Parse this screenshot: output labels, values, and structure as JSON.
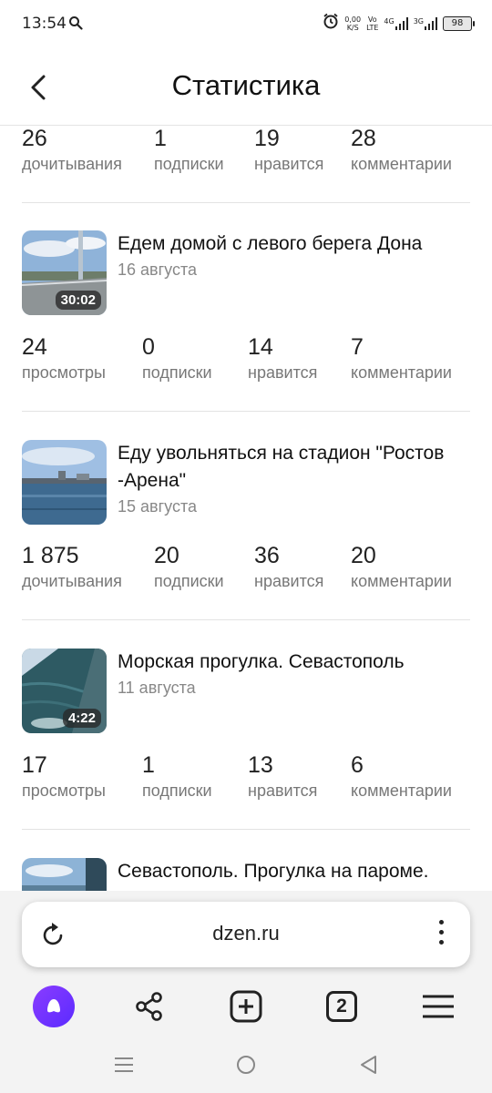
{
  "status_bar": {
    "time": "13:54",
    "net_speed_value": "0,00",
    "net_speed_unit": "K/S",
    "volte_top": "Vo",
    "volte_bottom": "LTE",
    "signal1": "4G",
    "signal2": "3G",
    "battery": "98"
  },
  "header": {
    "title": "Статистика"
  },
  "top_stats": [
    {
      "value": "26",
      "label": "дочитывания"
    },
    {
      "value": "1",
      "label": "подписки"
    },
    {
      "value": "19",
      "label": "нравится"
    },
    {
      "value": "28",
      "label": "комментарии"
    }
  ],
  "videos": [
    {
      "title": "Едем домой с левого берега Дона",
      "date": "16 августа",
      "duration": "30:02",
      "stats": [
        {
          "value": "24",
          "label": "просмотры"
        },
        {
          "value": "0",
          "label": "подписки"
        },
        {
          "value": "14",
          "label": "нравится"
        },
        {
          "value": "7",
          "label": "комментарии"
        }
      ]
    },
    {
      "title": "Еду увольняться на стадион \"Ростов -Арена\"",
      "date": "15 августа",
      "duration": "",
      "stats": [
        {
          "value": "1 875",
          "label": "дочитывания"
        },
        {
          "value": "20",
          "label": "подписки"
        },
        {
          "value": "36",
          "label": "нравится"
        },
        {
          "value": "20",
          "label": "комментарии"
        }
      ]
    },
    {
      "title": "Морская прогулка. Севастополь",
      "date": "11 августа",
      "duration": "4:22",
      "stats": [
        {
          "value": "17",
          "label": "просмотры"
        },
        {
          "value": "1",
          "label": "подписки"
        },
        {
          "value": "13",
          "label": "нравится"
        },
        {
          "value": "6",
          "label": "комментарии"
        }
      ]
    },
    {
      "title": "Севастополь. Прогулка на пароме.",
      "date": "",
      "duration": ""
    }
  ],
  "browser": {
    "url": "dzen.ru",
    "tab_count": "2"
  },
  "icons": {
    "search": "search-icon",
    "alarm": "alarm-icon",
    "back": "back-arrow-icon",
    "reload": "reload-icon",
    "more": "more-vertical-icon",
    "alice": "alice-assistant-icon",
    "share": "share-icon",
    "new_tab": "add-tab-icon",
    "tabs": "tabs-icon",
    "menu": "hamburger-menu-icon"
  },
  "colors": {
    "accent": "#6a35ff",
    "label_gray": "#777777",
    "divider": "#e3e3e3"
  }
}
